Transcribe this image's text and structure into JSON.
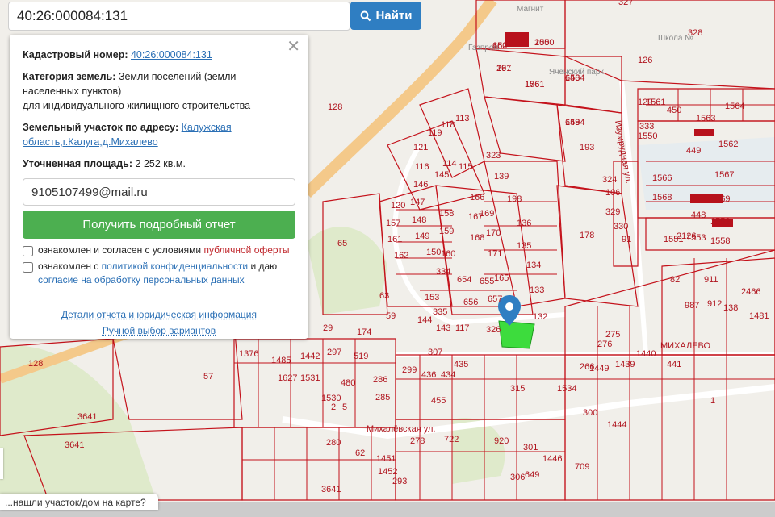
{
  "search": {
    "value": "40:26:000084:131",
    "button_label": "Найти"
  },
  "panel": {
    "cad_label": "Кадастровый номер:",
    "cad_value": "40:26:000084:131",
    "cat_label": "Категория земель:",
    "cat_value1": "Земли поселений (земли",
    "cat_value2": "населенных пунктов)",
    "cat_value3": "для индивидуального жилищного строительства",
    "addr_label": "Земельный участок по адресу:",
    "addr_value1": "Калужская",
    "addr_value2": "область,г.Калуга,д.Михалево",
    "area_label": "Уточненная площадь:",
    "area_value": "2 252 кв.м.",
    "email_value": "9105107499@mail.ru",
    "report_button": "Получить подробный отчет",
    "consent1_prefix": "ознакомлен и согласен с условиями",
    "consent1_link": "публичной оферты",
    "consent2_prefix": "ознакомлен с",
    "consent2_link": "политикой конфиденциальности",
    "consent2_mid": "и даю",
    "consent2_link2": "согласие на обработку персональных данных",
    "link_details": "Детали отчета и юридическая информация",
    "link_manual": "Ручной выбор вариантов"
  },
  "bottom_tip": "...нашли участок/дом на карте?",
  "map": {
    "street_label": "Михалёвская ул.",
    "village_label": "МИХАЛЕВО",
    "street_label2": "Изумрудная ул.",
    "poi": [
      "Магнит",
      "Газпром",
      "Школа №",
      "Яченский парк"
    ],
    "parcel_labels": [
      "197",
      "176",
      "200",
      "660",
      "658",
      "659",
      "193",
      "178",
      "65",
      "63",
      "59",
      "29",
      "174",
      "128",
      "1376",
      "1485",
      "1442",
      "1627",
      "297",
      "519",
      "1531",
      "480",
      "286",
      "285",
      "1530",
      "2",
      "5",
      "299",
      "307",
      "436",
      "434",
      "435",
      "455",
      "315",
      "1534",
      "1449",
      "1439",
      "276",
      "275",
      "266",
      "1440",
      "1444",
      "1446",
      "709",
      "300",
      "301",
      "649",
      "306",
      "920",
      "722",
      "278",
      "1451",
      "1452",
      "280",
      "293",
      "62",
      "3641",
      "3641",
      "3641",
      "57",
      "1",
      "441",
      "82",
      "987",
      "911",
      "912",
      "138",
      "1569",
      "1567",
      "1568",
      "1566",
      "1562",
      "1561",
      "1550",
      "1553",
      "1551",
      "1558",
      "1552",
      "448",
      "449",
      "450",
      "1564",
      "1563",
      "324",
      "106",
      "329",
      "330",
      "91",
      "323",
      "139",
      "198",
      "166",
      "169",
      "170",
      "171",
      "167",
      "168",
      "136",
      "135",
      "134",
      "133",
      "132",
      "165",
      "657",
      "655",
      "654",
      "656",
      "153",
      "335",
      "334",
      "150",
      "149",
      "148",
      "147",
      "146",
      "145",
      "158",
      "159",
      "160",
      "161",
      "162",
      "157",
      "120",
      "121",
      "119",
      "118",
      "113",
      "114",
      "115",
      "116",
      "117",
      "144",
      "143",
      "326",
      "327",
      "328",
      "126",
      "128",
      "129",
      "333",
      "2126",
      "2466",
      "1481",
      "261",
      "1561",
      "1550",
      "152",
      "1464",
      "1484"
    ]
  }
}
